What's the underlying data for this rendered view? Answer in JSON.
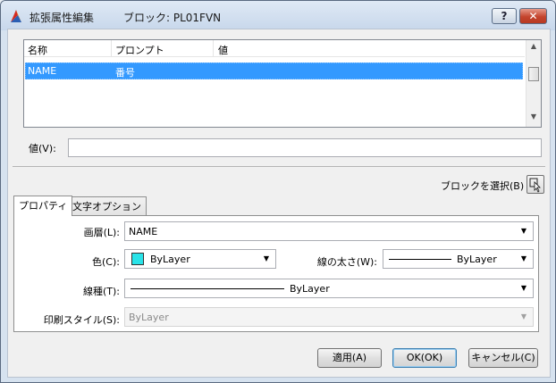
{
  "window": {
    "title": "拡張属性編集",
    "block_label": "ブロック: PL01FVN",
    "help_button": "?",
    "close_button": "✕"
  },
  "attribute_list": {
    "columns": [
      "名称",
      "プロンプト",
      "値"
    ],
    "rows": [
      {
        "name": "NAME",
        "prompt": "番号",
        "value": "",
        "selected": true
      }
    ]
  },
  "value_field": {
    "label": "値(V):",
    "value": ""
  },
  "select_block": {
    "label": "ブロックを選択(B)"
  },
  "tabs": [
    {
      "label": "プロパティ",
      "active": true
    },
    {
      "label": "文字オプション",
      "active": false
    }
  ],
  "properties": {
    "layer": {
      "label": "画層(L):",
      "value": "NAME"
    },
    "color": {
      "label": "色(C):",
      "value": "ByLayer",
      "swatch_color": "#29e3e8"
    },
    "lineweight": {
      "label": "線の太さ(W):",
      "value": "ByLayer"
    },
    "linetype": {
      "label": "線種(T):",
      "value": "ByLayer"
    },
    "plot_style": {
      "label": "印刷スタイル(S):",
      "value": "ByLayer",
      "disabled": true
    }
  },
  "buttons": {
    "apply": "適用(A)",
    "ok": "OK(OK)",
    "cancel": "キャンセル(C)"
  },
  "colors": {
    "selection": "#3399ff",
    "close_button": "#c4442d"
  }
}
